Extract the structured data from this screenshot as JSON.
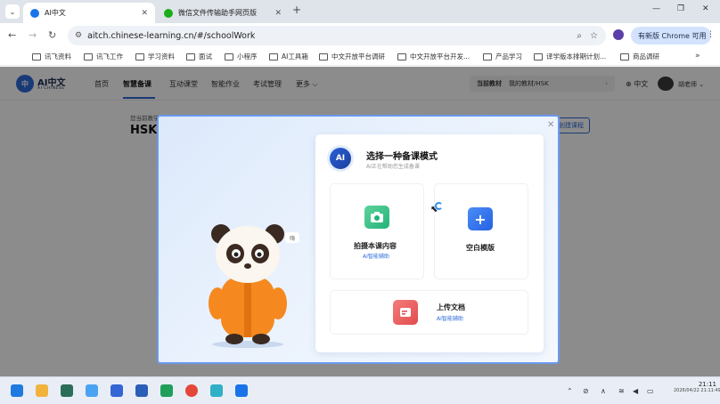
{
  "browser": {
    "tabs": [
      {
        "title": "AI中文",
        "active": true
      },
      {
        "title": "微信文件传输助手网页版",
        "active": false
      }
    ],
    "new_tab_symbol": "+",
    "window_controls": {
      "minimize": "—",
      "restore": "❐",
      "close": "✕"
    },
    "url": "aitch.chinese-learning.cn/#/schoolWork",
    "update_button": "有新版 Chrome 可用",
    "bookmarks": [
      "讯飞资料",
      "讯飞工作",
      "学习资料",
      "面试",
      "小程序",
      "AI工具箱",
      "中文开放平台调研",
      "中文开放平台开发...",
      "产品学习",
      "译学版本排期计划...",
      "商品调研"
    ],
    "bookmarks_more": "»"
  },
  "site": {
    "logo_mark": "中",
    "logo_text": "AI中文",
    "logo_sub": "AI·CHINESE",
    "nav": [
      "首页",
      "智慧备课",
      "互动课堂",
      "智能作业",
      "考试管理",
      "更多 ⌵"
    ],
    "active_nav": "智慧备课",
    "crumb_label": "当前教材",
    "crumb_value": "我的教材/HSK",
    "lang": "中文",
    "user": "胡老师",
    "bg_hint": "您当前教学",
    "bg_title": "HSK",
    "bg_button": "创建课程"
  },
  "modal": {
    "close": "✕",
    "speech": "嗨",
    "badge": "AI",
    "title": "选择一种备课模式",
    "subtitle": "AI正在帮助您生成备课",
    "options": {
      "photo": {
        "label": "拍摄本课内容",
        "sub": "AI智能辅助"
      },
      "blank": {
        "label": "空白模版"
      },
      "upload": {
        "label": "上传文档",
        "sub": "AI智能辅助"
      }
    }
  },
  "taskbar": {
    "time": "21:11",
    "date": "2026/04/22 21:11:49"
  },
  "colors": {
    "brand": "#2f6bd8",
    "modal_border": "#6b9af0",
    "photo_icon": "#22b37a",
    "blank_icon": "#2562e2",
    "upload_icon": "#e24d4d"
  }
}
